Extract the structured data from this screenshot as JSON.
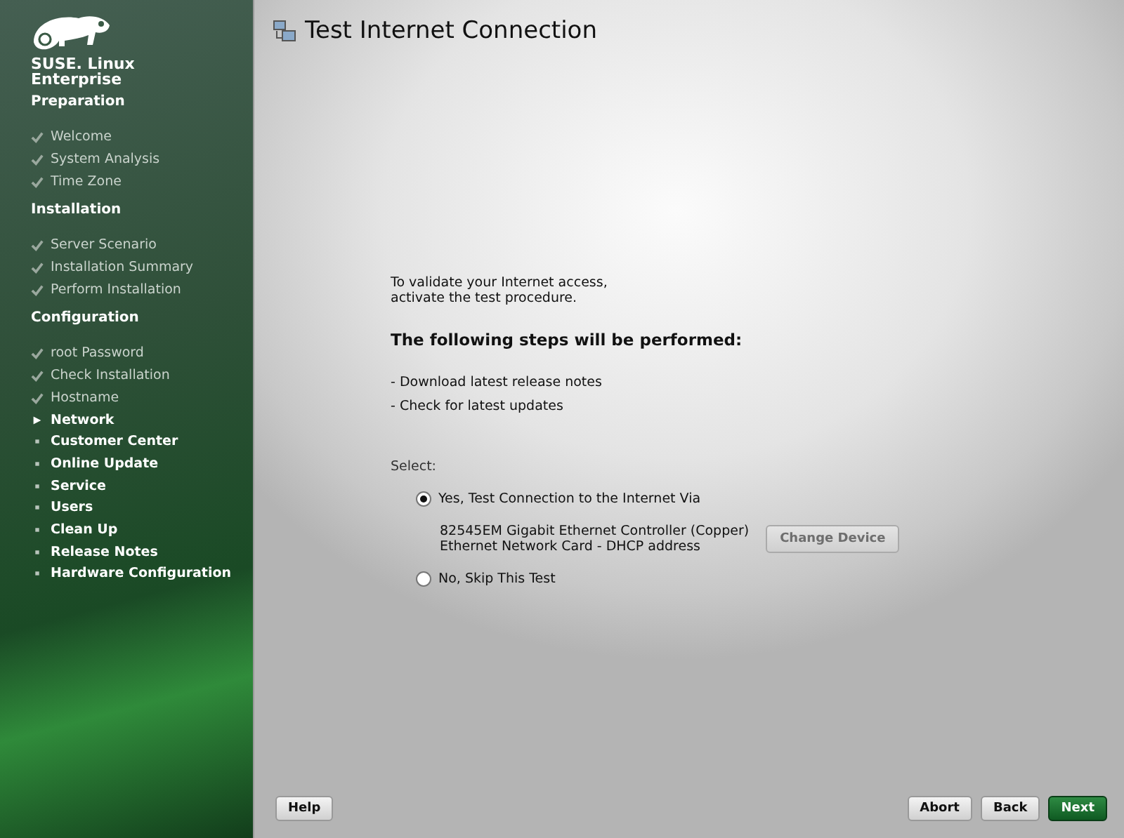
{
  "brand": {
    "line_1": "SUSE. Linux",
    "line_2": "Enterprise"
  },
  "sidebar": {
    "sections": [
      {
        "heading": "Preparation",
        "items": [
          {
            "label": "Welcome",
            "kind": "done"
          },
          {
            "label": "System Analysis",
            "kind": "done"
          },
          {
            "label": "Time Zone",
            "kind": "done"
          }
        ]
      },
      {
        "heading": "Installation",
        "items": [
          {
            "label": "Server Scenario",
            "kind": "done"
          },
          {
            "label": "Installation Summary",
            "kind": "done"
          },
          {
            "label": "Perform Installation",
            "kind": "done"
          }
        ]
      },
      {
        "heading": "Configuration",
        "items": [
          {
            "label": "root Password",
            "kind": "done"
          },
          {
            "label": "Check Installation",
            "kind": "done"
          },
          {
            "label": "Hostname",
            "kind": "done"
          },
          {
            "label": "Network",
            "kind": "current"
          },
          {
            "label": "Customer Center",
            "kind": "pending"
          },
          {
            "label": "Online Update",
            "kind": "pending"
          },
          {
            "label": "Service",
            "kind": "pending"
          },
          {
            "label": "Users",
            "kind": "pending"
          },
          {
            "label": "Clean Up",
            "kind": "pending"
          },
          {
            "label": "Release Notes",
            "kind": "pending"
          },
          {
            "label": "Hardware Configuration",
            "kind": "pending"
          }
        ]
      }
    ]
  },
  "page": {
    "title": "Test Internet Connection",
    "intro": [
      "To validate your Internet access,",
      "activate the test procedure."
    ],
    "steps_heading": "The following steps will be performed:",
    "steps": [
      "- Download latest release notes",
      "- Check for latest updates"
    ],
    "select_label": "Select:",
    "options": [
      {
        "label": "Yes, Test Connection to the Internet Via",
        "selected": true,
        "device": [
          "82545EM Gigabit Ethernet Controller (Copper)",
          "Ethernet Network Card - DHCP address"
        ],
        "button": {
          "label": "Change Device",
          "disabled": true
        }
      },
      {
        "label": "No, Skip This Test",
        "selected": false
      }
    ]
  },
  "buttons_left": [
    {
      "label": "Help"
    }
  ],
  "buttons_right": [
    {
      "label": "Abort",
      "kind": "plain"
    },
    {
      "label": "Back",
      "kind": "plain"
    },
    {
      "label": "Next",
      "kind": "primary"
    }
  ]
}
